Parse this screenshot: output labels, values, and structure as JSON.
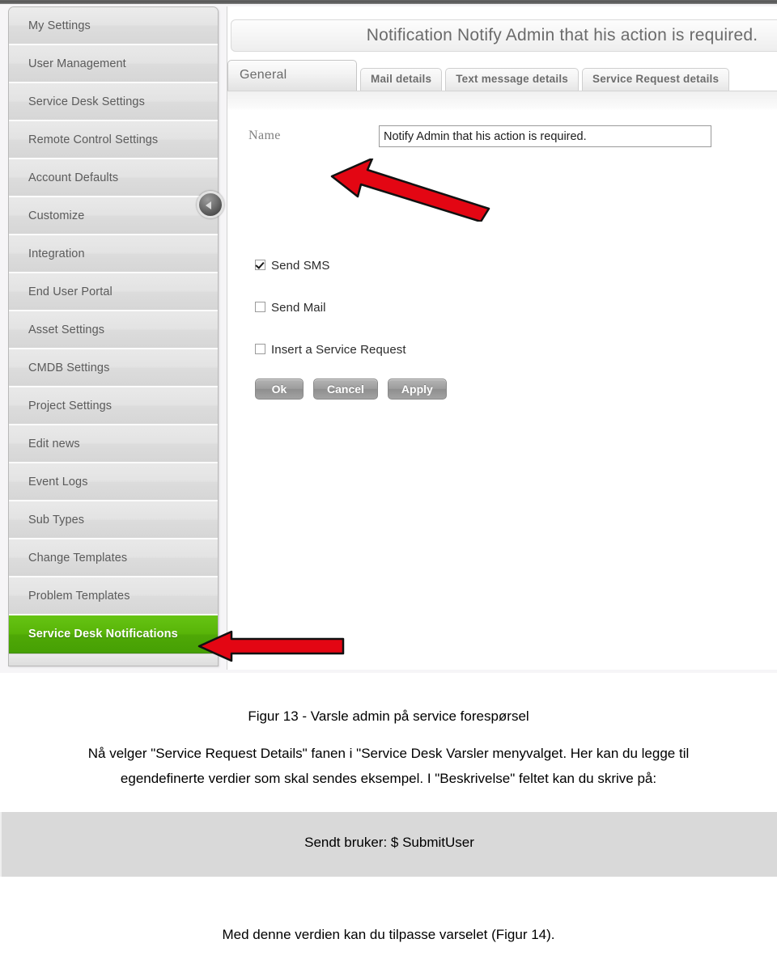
{
  "app": {
    "panel_title": "Notification Notify Admin that his action is required.",
    "sidebar": {
      "items": [
        {
          "label": "My Settings",
          "active": false
        },
        {
          "label": "User Management",
          "active": false
        },
        {
          "label": "Service Desk Settings",
          "active": false
        },
        {
          "label": "Remote Control Settings",
          "active": false
        },
        {
          "label": "Account Defaults",
          "active": false
        },
        {
          "label": "Customize",
          "active": false
        },
        {
          "label": "Integration",
          "active": false
        },
        {
          "label": "End User Portal",
          "active": false
        },
        {
          "label": "Asset Settings",
          "active": false
        },
        {
          "label": "CMDB Settings",
          "active": false
        },
        {
          "label": "Project Settings",
          "active": false
        },
        {
          "label": "Edit news",
          "active": false
        },
        {
          "label": "Event Logs",
          "active": false
        },
        {
          "label": "Sub Types",
          "active": false
        },
        {
          "label": "Change Templates",
          "active": false
        },
        {
          "label": "Problem Templates",
          "active": false
        },
        {
          "label": "Service Desk Notifications",
          "active": true
        }
      ]
    },
    "tabs": [
      {
        "label": "General",
        "active": true
      },
      {
        "label": "Mail details",
        "active": false
      },
      {
        "label": "Text message details",
        "active": false
      },
      {
        "label": "Service Request details",
        "active": false
      }
    ],
    "form": {
      "name_label": "Name",
      "name_value": "Notify Admin that his action is required.",
      "checkboxes": [
        {
          "label": "Send SMS",
          "checked": true
        },
        {
          "label": "Send Mail",
          "checked": false
        },
        {
          "label": "Insert a Service Request",
          "checked": false
        }
      ],
      "buttons": [
        {
          "label": "Ok"
        },
        {
          "label": "Cancel"
        },
        {
          "label": "Apply"
        }
      ]
    },
    "colors": {
      "active_sidebar_green": "#58b408",
      "annotation_red": "#e30613",
      "code_block_gray": "#d9d9d9"
    }
  },
  "document": {
    "figure_caption": "Figur 13 - Varsle admin på service forespørsel",
    "paragraph": "Nå velger \"Service Request Details\" fanen i \"Service Desk Varsler menyvalget.  Her kan du legge til egendefinerte verdier som skal sendes eksempel. I \"Beskrivelse\" feltet kan du skrive på:",
    "code_snippet": "Sendt bruker: $ SubmitUser",
    "closing_line": "Med denne verdien kan du tilpasse varselet (Figur 14)."
  }
}
